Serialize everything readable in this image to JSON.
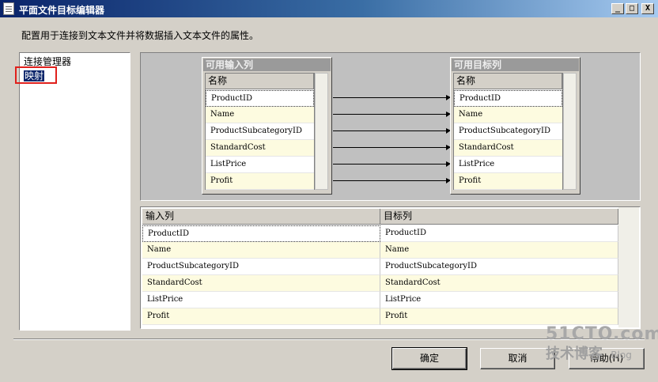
{
  "window": {
    "title": "平面文件目标编辑器",
    "controls": {
      "minimize": "_",
      "maximize": "□",
      "close": "X"
    }
  },
  "description": "配置用于连接到文本文件并将数据插入文本文件的属性。",
  "nav": {
    "items": [
      {
        "label": "连接管理器",
        "selected": false
      },
      {
        "label": "映射",
        "selected": true
      }
    ]
  },
  "available_inputs": {
    "title": "可用输入列",
    "header": "名称",
    "rows": [
      "ProductID",
      "Name",
      "ProductSubcategoryID",
      "StandardCost",
      "ListPrice",
      "Profit"
    ]
  },
  "available_targets": {
    "title": "可用目标列",
    "header": "名称",
    "rows": [
      "ProductID",
      "Name",
      "ProductSubcategoryID",
      "StandardCost",
      "ListPrice",
      "Profit"
    ]
  },
  "mapping_grid": {
    "columns": [
      "输入列",
      "目标列"
    ],
    "rows": [
      [
        "ProductID",
        "ProductID"
      ],
      [
        "Name",
        "Name"
      ],
      [
        "ProductSubcategoryID",
        "ProductSubcategoryID"
      ],
      [
        "StandardCost",
        "StandardCost"
      ],
      [
        "ListPrice",
        "ListPrice"
      ],
      [
        "Profit",
        "Profit"
      ]
    ]
  },
  "buttons": {
    "ok": "确定",
    "cancel": "取消",
    "help": "帮助(H)"
  },
  "watermark": {
    "site": "51CTO.com",
    "sub": "技术博客",
    "blog": "Blog"
  },
  "colors": {
    "titlebar": "#0a246a",
    "selection": "#0a246a",
    "highlight_box": "#e0201c",
    "alt_row": "#fdfbe0"
  }
}
